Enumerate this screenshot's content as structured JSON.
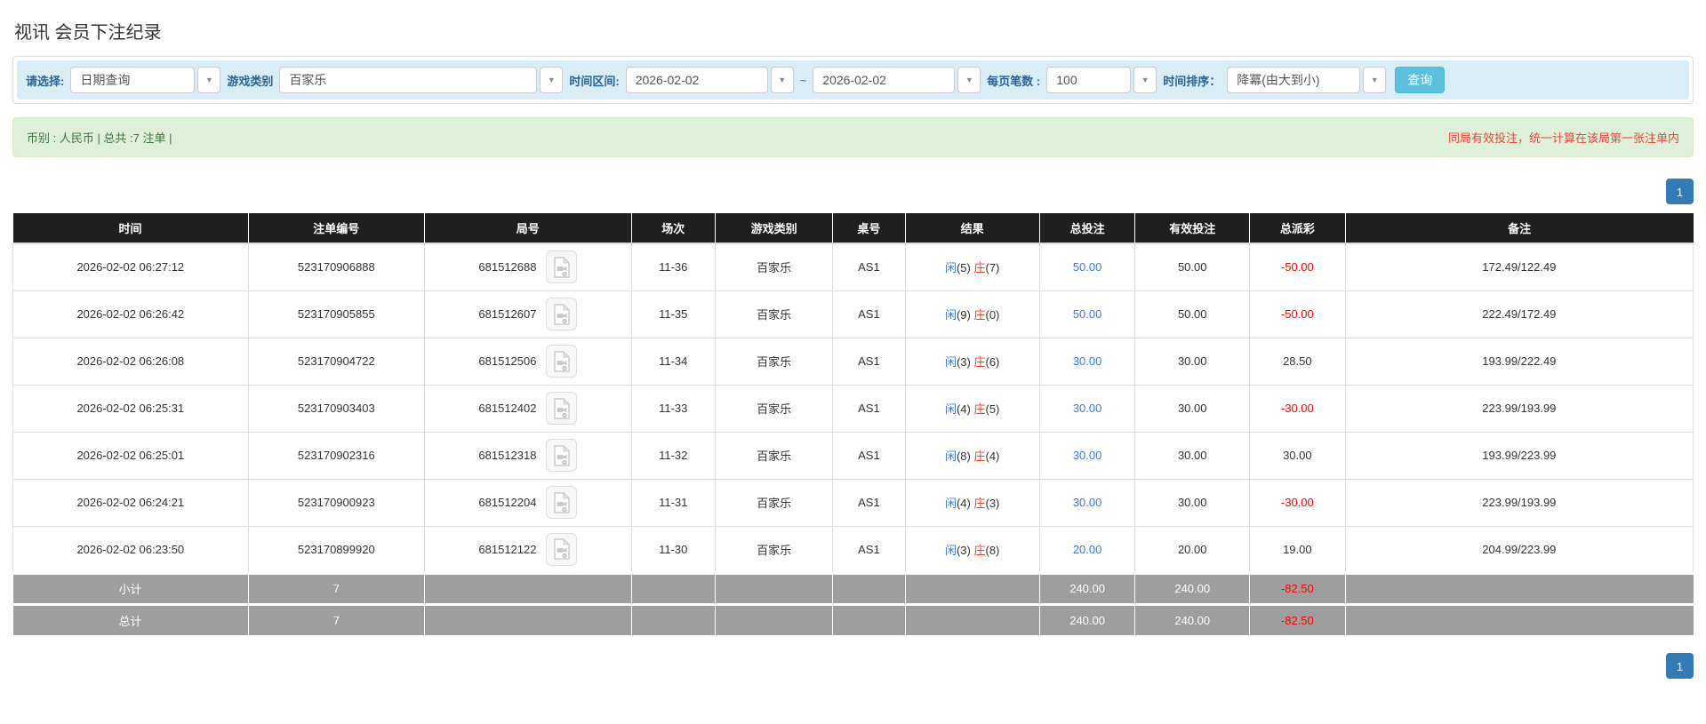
{
  "page": {
    "title": "视讯 会员下注纪录"
  },
  "filters": {
    "caret": "▼",
    "select_label": "请选择:",
    "select_value": "日期查询",
    "game_label": "游戏类别",
    "game_value": "百家乐",
    "range_label": "时间区间:",
    "date_from": "2026-02-02",
    "tilde": "~",
    "date_to": "2026-02-02",
    "page_size_label": "每页笔数 :",
    "page_size_value": "100",
    "sort_label": "时间排序：",
    "sort_value": "降冪(由大到小)",
    "search_button": "查询"
  },
  "summary": {
    "left_text": "币别 : 人民币 | 总共 :7 注单 |",
    "right_notice": "同局有效投注，统一计算在该局第一张注单内"
  },
  "pagination": {
    "page": "1"
  },
  "table": {
    "headers": [
      "时间",
      "注单编号",
      "局号",
      "场次",
      "游戏类别",
      "桌号",
      "结果",
      "总投注",
      "有效投注",
      "总派彩",
      "备注"
    ],
    "rows": [
      {
        "time": "2026-02-02 06:27:12",
        "bet_id": "523170906888",
        "round_id": "681512688",
        "session": "11-36",
        "game": "百家乐",
        "table_no": "AS1",
        "result": {
          "player_label": "闲",
          "player_value": "(5)",
          "banker_label": "庄",
          "banker_value": "(7)"
        },
        "total_bet": "50.00",
        "valid_bet": "50.00",
        "payout": "-50.00",
        "remark": "172.49/122.49"
      },
      {
        "time": "2026-02-02 06:26:42",
        "bet_id": "523170905855",
        "round_id": "681512607",
        "session": "11-35",
        "game": "百家乐",
        "table_no": "AS1",
        "result": {
          "player_label": "闲",
          "player_value": "(9)",
          "banker_label": "庄",
          "banker_value": "(0)"
        },
        "total_bet": "50.00",
        "valid_bet": "50.00",
        "payout": "-50.00",
        "remark": "222.49/172.49"
      },
      {
        "time": "2026-02-02 06:26:08",
        "bet_id": "523170904722",
        "round_id": "681512506",
        "session": "11-34",
        "game": "百家乐",
        "table_no": "AS1",
        "result": {
          "player_label": "闲",
          "player_value": "(3)",
          "banker_label": "庄",
          "banker_value": "(6)"
        },
        "total_bet": "30.00",
        "valid_bet": "30.00",
        "payout": "28.50",
        "remark": "193.99/222.49"
      },
      {
        "time": "2026-02-02 06:25:31",
        "bet_id": "523170903403",
        "round_id": "681512402",
        "session": "11-33",
        "game": "百家乐",
        "table_no": "AS1",
        "result": {
          "player_label": "闲",
          "player_value": "(4)",
          "banker_label": "庄",
          "banker_value": "(5)"
        },
        "total_bet": "30.00",
        "valid_bet": "30.00",
        "payout": "-30.00",
        "remark": "223.99/193.99"
      },
      {
        "time": "2026-02-02 06:25:01",
        "bet_id": "523170902316",
        "round_id": "681512318",
        "session": "11-32",
        "game": "百家乐",
        "table_no": "AS1",
        "result": {
          "player_label": "闲",
          "player_value": "(8)",
          "banker_label": "庄",
          "banker_value": "(4)"
        },
        "total_bet": "30.00",
        "valid_bet": "30.00",
        "payout": "30.00",
        "remark": "193.99/223.99"
      },
      {
        "time": "2026-02-02 06:24:21",
        "bet_id": "523170900923",
        "round_id": "681512204",
        "session": "11-31",
        "game": "百家乐",
        "table_no": "AS1",
        "result": {
          "player_label": "闲",
          "player_value": "(4)",
          "banker_label": "庄",
          "banker_value": "(3)"
        },
        "total_bet": "30.00",
        "valid_bet": "30.00",
        "payout": "-30.00",
        "remark": "223.99/193.99"
      },
      {
        "time": "2026-02-02 06:23:50",
        "bet_id": "523170899920",
        "round_id": "681512122",
        "session": "11-30",
        "game": "百家乐",
        "table_no": "AS1",
        "result": {
          "player_label": "闲",
          "player_value": "(3)",
          "banker_label": "庄",
          "banker_value": "(8)"
        },
        "total_bet": "20.00",
        "valid_bet": "20.00",
        "payout": "19.00",
        "remark": "204.99/223.99"
      }
    ],
    "subtotal": {
      "label": "小计",
      "count": "7",
      "total_bet": "240.00",
      "valid_bet": "240.00",
      "payout": "-82.50",
      "remark": ""
    },
    "total": {
      "label": "总计",
      "count": "7",
      "total_bet": "240.00",
      "valid_bet": "240.00",
      "payout": "-82.50",
      "remark": ""
    }
  },
  "icons": {
    "dropdown_caret": "video-replay dropdown carets",
    "video_replay": "video-file-icon"
  },
  "colors": {
    "accent_link_blue": "#3b79dd",
    "banker_red": "#ea3a2e",
    "negative_red": "#ff0000",
    "header_black": "#1f1f1f",
    "footer_gray": "#9e9e9e",
    "panel_blue": "#d9edf7",
    "alert_green_bg": "#dff0d8",
    "alert_green_text": "#3c763d",
    "notice_red": "#e9443b",
    "search_button_blue": "#5bc0de",
    "pager_blue": "#337ab7"
  }
}
